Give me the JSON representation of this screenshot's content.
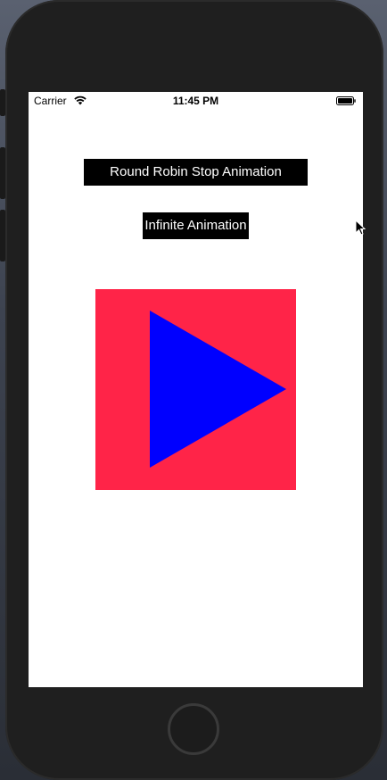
{
  "status_bar": {
    "carrier": "Carrier",
    "time": "11:45 PM",
    "icons": [
      "wifi-icon",
      "battery-icon"
    ]
  },
  "buttons": {
    "round_robin_label": "Round Robin Stop Animation",
    "infinite_label": "Infinite Animation"
  },
  "animation_view": {
    "background_color": "#ff2448",
    "shape": "play-triangle",
    "shape_color": "#0000ff"
  },
  "colors": {
    "device_frame": "#1f1f1f",
    "screen": "#ffffff",
    "button_bg": "#000000",
    "button_text": "#ffffff"
  }
}
